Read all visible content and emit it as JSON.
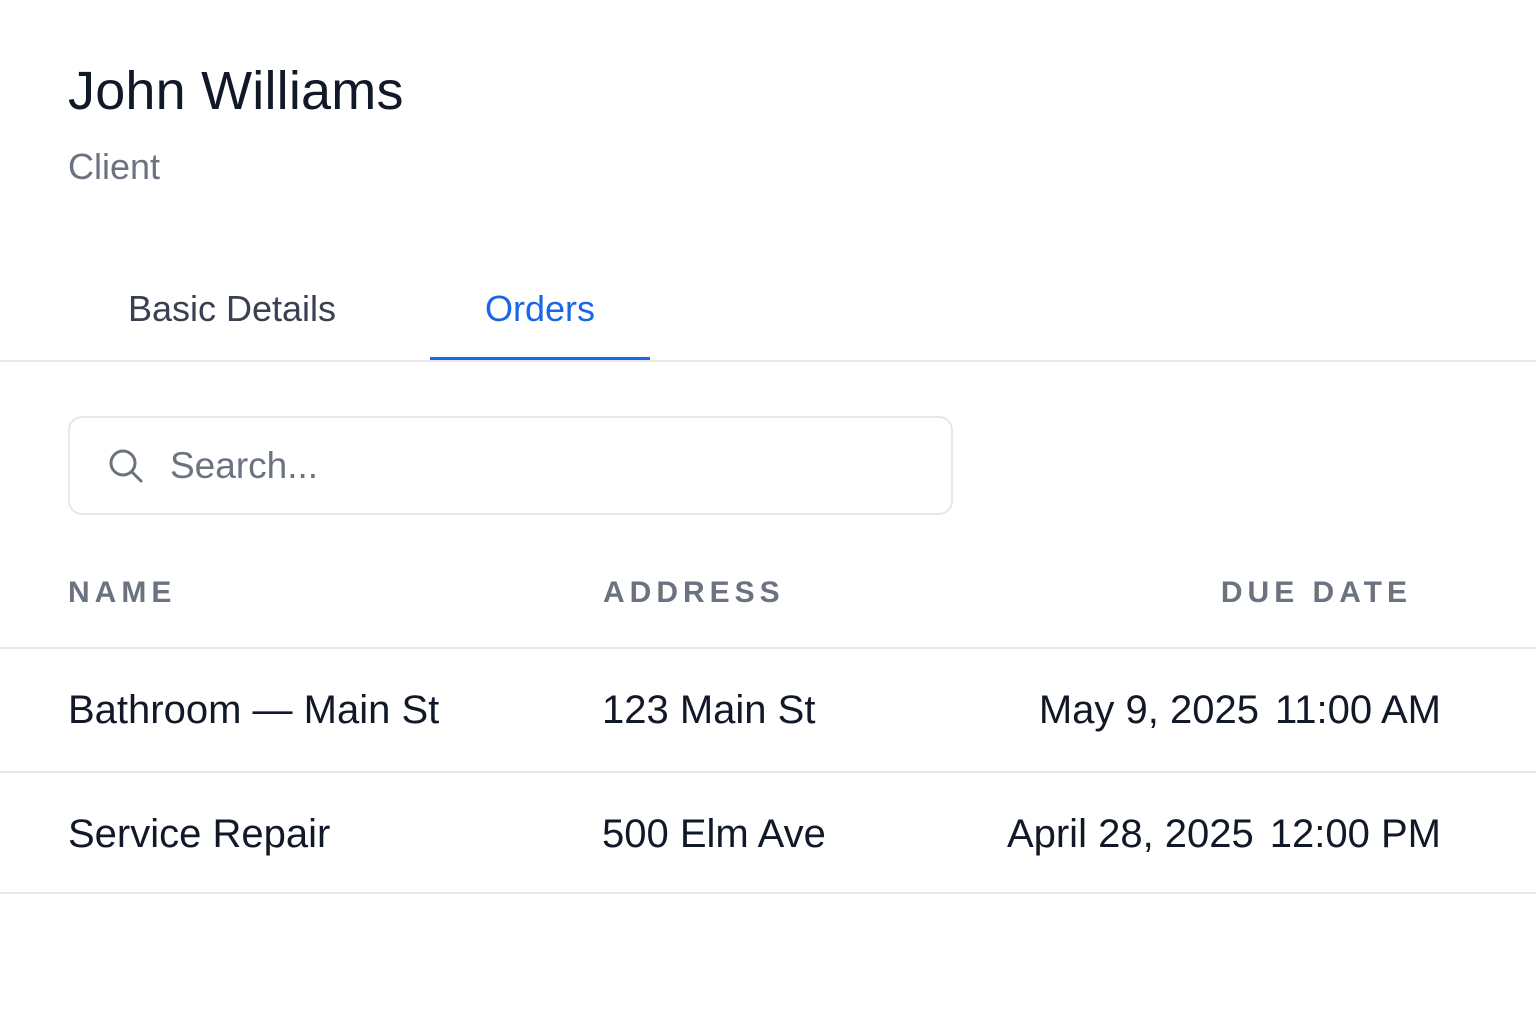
{
  "header": {
    "name": "John Williams",
    "role": "Client"
  },
  "tabs": [
    {
      "label": "Basic Details",
      "active": false
    },
    {
      "label": "Orders",
      "active": true
    }
  ],
  "search": {
    "placeholder": "Search...",
    "value": "",
    "icon": "search-icon"
  },
  "table": {
    "columns": [
      "NAME",
      "ADDRESS",
      "DUE DATE"
    ],
    "rows": [
      {
        "name": "Bathroom — Main St",
        "address": "123 Main St",
        "due_date": "May 9, 2025",
        "due_time": "11:00 AM"
      },
      {
        "name": "Service Repair",
        "address": "500 Elm Ave",
        "due_date": "April 28, 2025",
        "due_time": "12:00 PM"
      }
    ]
  },
  "colors": {
    "accent": "#1a66e8",
    "muted_text": "#6b7280",
    "border": "#e5e7eb"
  }
}
